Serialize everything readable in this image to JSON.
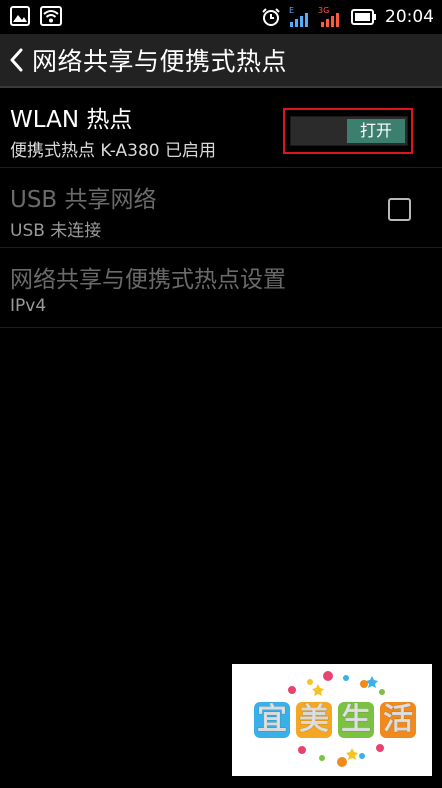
{
  "status_bar": {
    "time": "20:04",
    "left_icons": [
      "image-icon",
      "wifi-icon"
    ],
    "right_icons": [
      "alarm-icon",
      "signal-e-icon",
      "signal-3g-icon",
      "battery-icon"
    ],
    "signal_labels": {
      "e": "E",
      "3g": "3G"
    }
  },
  "action_bar": {
    "back_icon": "chevron-left-icon",
    "title": "网络共享与便携式热点"
  },
  "items": [
    {
      "title": "WLAN 热点",
      "summary": "便携式热点 K-A380 已启用",
      "toggle_label": "打开",
      "toggle_on": true
    },
    {
      "title": "USB 共享网络",
      "summary": "USB 未连接",
      "checked": false,
      "enabled": false
    },
    {
      "title": "网络共享与便携式热点设置",
      "summary": "IPv4",
      "enabled": false
    }
  ],
  "watermark": {
    "chars": [
      "宜",
      "美",
      "生",
      "活"
    ],
    "colors": [
      "#3ab0e8",
      "#f5a623",
      "#7cc242",
      "#f08a1c"
    ]
  },
  "colors": {
    "background": "#000000",
    "action_bar": "#222222",
    "toggle_on": "#3d7f6f",
    "highlight": "#e0141e"
  }
}
